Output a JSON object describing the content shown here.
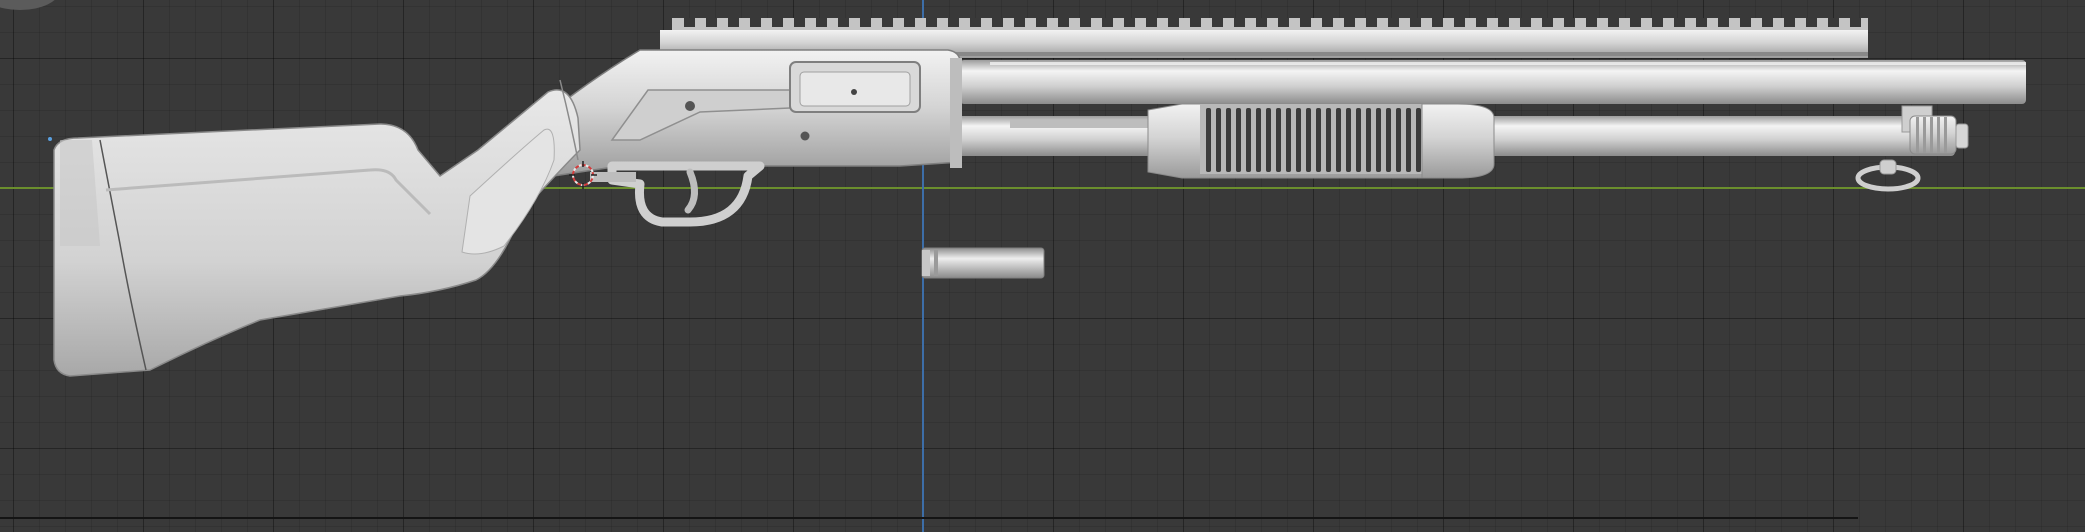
{
  "app": {
    "view": "3D viewport",
    "background_color": "#393939",
    "grid_color": "#2e2e2e",
    "x_axis_color": "#6b8f2d",
    "y_axis_color": "#3d6ea8",
    "model_color": "#d6d6d6"
  },
  "scene": {
    "objects": [
      {
        "name": "shotgun-model",
        "kind": "mesh"
      },
      {
        "name": "shotgun-shell",
        "kind": "mesh"
      },
      {
        "name": "3d-cursor",
        "kind": "cursor"
      }
    ]
  }
}
